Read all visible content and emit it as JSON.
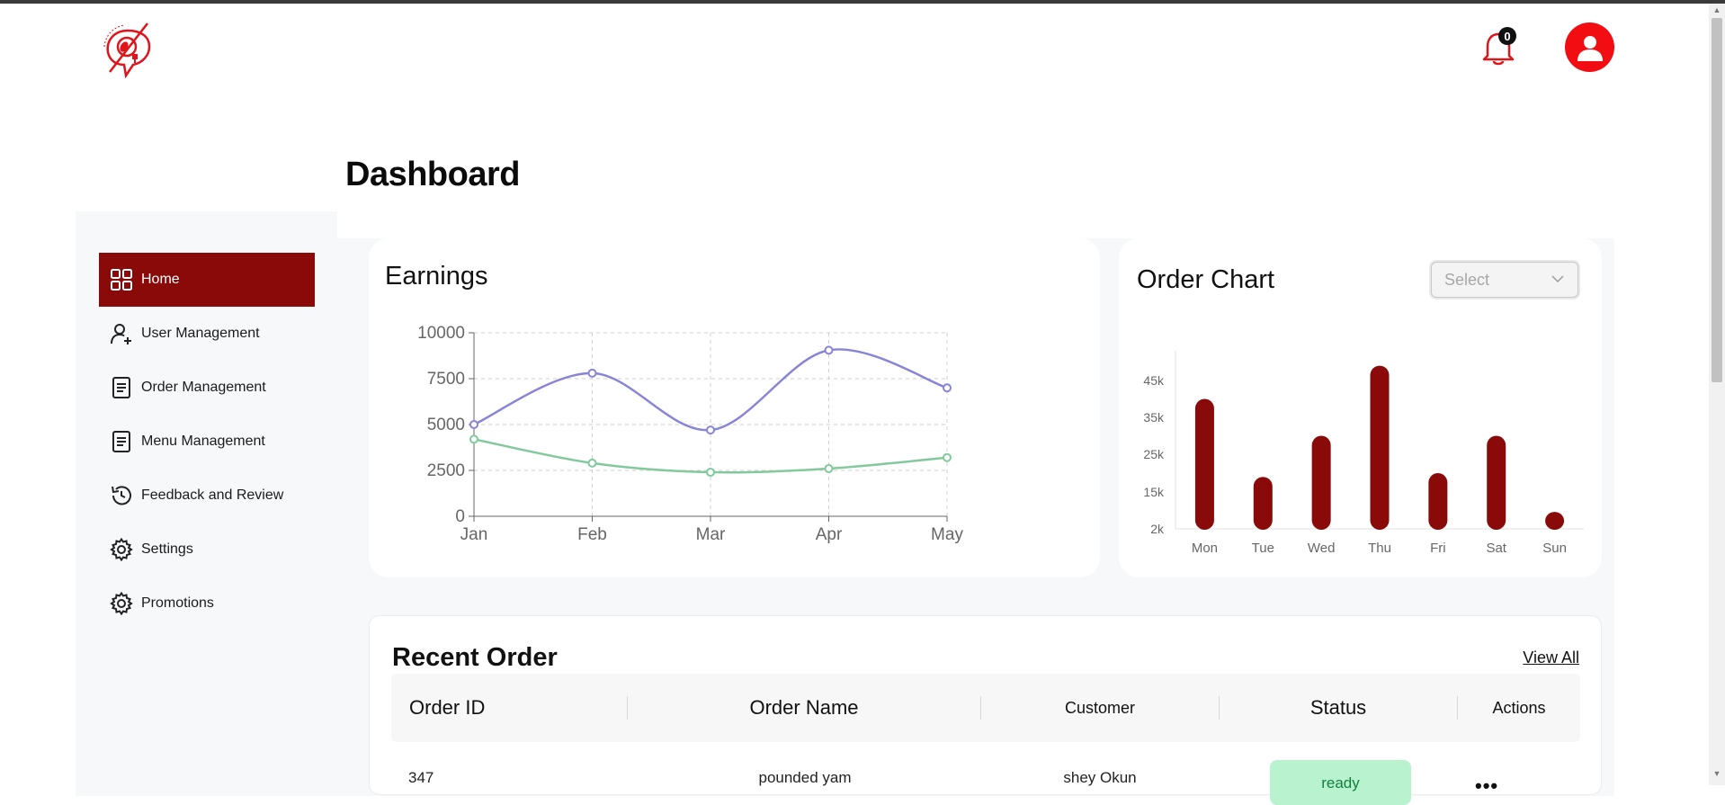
{
  "header": {
    "notifications_count": "0"
  },
  "page": {
    "title": "Dashboard"
  },
  "sidebar": {
    "items": [
      {
        "label": "Home",
        "icon": "grid-icon",
        "active": true
      },
      {
        "label": "User Management",
        "icon": "user-plus-icon"
      },
      {
        "label": "Order Management",
        "icon": "document-icon"
      },
      {
        "label": "Menu Management",
        "icon": "document-icon"
      },
      {
        "label": "Feedback and Review",
        "icon": "history-icon"
      },
      {
        "label": "Settings",
        "icon": "gear-icon"
      },
      {
        "label": "Promotions",
        "icon": "gear-icon"
      }
    ]
  },
  "earnings": {
    "title": "Earnings",
    "chart_data": {
      "type": "line",
      "categories": [
        "Jan",
        "Feb",
        "Mar",
        "Apr",
        "May"
      ],
      "series": [
        {
          "color": "#8884d8",
          "values": [
            5000,
            7800,
            4700,
            9050,
            7000
          ]
        },
        {
          "color": "#82ca9d",
          "values": [
            4200,
            2900,
            2400,
            2600,
            3200
          ]
        }
      ],
      "yticks": [
        "0",
        "2500",
        "5000",
        "7500",
        "10000"
      ],
      "ylim": [
        0,
        10000
      ],
      "grid": true
    }
  },
  "order_chart": {
    "title": "Order Chart",
    "select_placeholder": "Select",
    "chart_data": {
      "type": "bar",
      "categories": [
        "Mon",
        "Tue",
        "Wed",
        "Thu",
        "Fri",
        "Sat",
        "Sun"
      ],
      "values": [
        40000,
        19000,
        30000,
        49000,
        20000,
        30000,
        8000
      ],
      "ytick_labels": [
        "2k",
        "15k",
        "25k",
        "35k",
        "45k"
      ],
      "color": "#8a0a0a"
    }
  },
  "recent_orders": {
    "title": "Recent Order",
    "view_all": "View All",
    "headers": [
      "Order ID",
      "Order Name",
      "Customer",
      "Status",
      "Actions"
    ],
    "rows": [
      {
        "id": "347",
        "name": "pounded yam",
        "customer": "shey Okun",
        "status": "ready",
        "actions": "•••"
      }
    ]
  },
  "colors": {
    "brand_red": "#f20d12",
    "active_nav": "#8a0a0a",
    "status_ready_bg": "#b8f2cf"
  }
}
